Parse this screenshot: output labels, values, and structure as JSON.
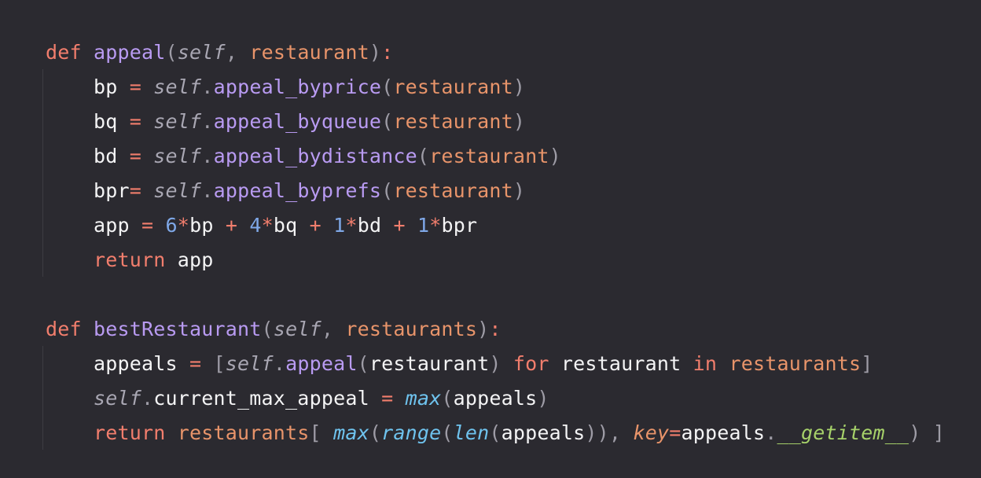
{
  "code": {
    "lines": [
      {
        "tokens": [
          {
            "t": "kw",
            "v": "def "
          },
          {
            "t": "fn",
            "v": "appeal"
          },
          {
            "t": "br",
            "v": "("
          },
          {
            "t": "slf",
            "v": "self"
          },
          {
            "t": "br",
            "v": ", "
          },
          {
            "t": "par",
            "v": "restaurant"
          },
          {
            "t": "br",
            "v": ")"
          },
          {
            "t": "op",
            "v": ":"
          }
        ]
      },
      {
        "tokens": [
          {
            "t": "tx",
            "v": "    bp "
          },
          {
            "t": "op",
            "v": "= "
          },
          {
            "t": "slf",
            "v": "self"
          },
          {
            "t": "br",
            "v": "."
          },
          {
            "t": "fn",
            "v": "appeal_byprice"
          },
          {
            "t": "br",
            "v": "("
          },
          {
            "t": "par",
            "v": "restaurant"
          },
          {
            "t": "br",
            "v": ")"
          }
        ]
      },
      {
        "tokens": [
          {
            "t": "tx",
            "v": "    bq "
          },
          {
            "t": "op",
            "v": "= "
          },
          {
            "t": "slf",
            "v": "self"
          },
          {
            "t": "br",
            "v": "."
          },
          {
            "t": "fn",
            "v": "appeal_byqueue"
          },
          {
            "t": "br",
            "v": "("
          },
          {
            "t": "par",
            "v": "restaurant"
          },
          {
            "t": "br",
            "v": ")"
          }
        ]
      },
      {
        "tokens": [
          {
            "t": "tx",
            "v": "    bd "
          },
          {
            "t": "op",
            "v": "= "
          },
          {
            "t": "slf",
            "v": "self"
          },
          {
            "t": "br",
            "v": "."
          },
          {
            "t": "fn",
            "v": "appeal_bydistance"
          },
          {
            "t": "br",
            "v": "("
          },
          {
            "t": "par",
            "v": "restaurant"
          },
          {
            "t": "br",
            "v": ")"
          }
        ]
      },
      {
        "tokens": [
          {
            "t": "tx",
            "v": "    bpr"
          },
          {
            "t": "op",
            "v": "= "
          },
          {
            "t": "slf",
            "v": "self"
          },
          {
            "t": "br",
            "v": "."
          },
          {
            "t": "fn",
            "v": "appeal_byprefs"
          },
          {
            "t": "br",
            "v": "("
          },
          {
            "t": "par",
            "v": "restaurant"
          },
          {
            "t": "br",
            "v": ")"
          }
        ]
      },
      {
        "tokens": [
          {
            "t": "tx",
            "v": "    app "
          },
          {
            "t": "op",
            "v": "= "
          },
          {
            "t": "num",
            "v": "6"
          },
          {
            "t": "op",
            "v": "*"
          },
          {
            "t": "tx",
            "v": "bp "
          },
          {
            "t": "op",
            "v": "+ "
          },
          {
            "t": "num",
            "v": "4"
          },
          {
            "t": "op",
            "v": "*"
          },
          {
            "t": "tx",
            "v": "bq "
          },
          {
            "t": "op",
            "v": "+ "
          },
          {
            "t": "num",
            "v": "1"
          },
          {
            "t": "op",
            "v": "*"
          },
          {
            "t": "tx",
            "v": "bd "
          },
          {
            "t": "op",
            "v": "+ "
          },
          {
            "t": "num",
            "v": "1"
          },
          {
            "t": "op",
            "v": "*"
          },
          {
            "t": "tx",
            "v": "bpr"
          }
        ]
      },
      {
        "tokens": [
          {
            "t": "tx",
            "v": "    "
          },
          {
            "t": "kw",
            "v": "return "
          },
          {
            "t": "tx",
            "v": "app"
          }
        ]
      },
      {
        "tokens": []
      },
      {
        "tokens": [
          {
            "t": "kw",
            "v": "def "
          },
          {
            "t": "fn",
            "v": "bestRestaurant"
          },
          {
            "t": "br",
            "v": "("
          },
          {
            "t": "slf",
            "v": "self"
          },
          {
            "t": "br",
            "v": ", "
          },
          {
            "t": "par",
            "v": "restaurants"
          },
          {
            "t": "br",
            "v": ")"
          },
          {
            "t": "op",
            "v": ":"
          }
        ]
      },
      {
        "tokens": [
          {
            "t": "tx",
            "v": "    appeals "
          },
          {
            "t": "op",
            "v": "= "
          },
          {
            "t": "br",
            "v": "["
          },
          {
            "t": "slf",
            "v": "self"
          },
          {
            "t": "br",
            "v": "."
          },
          {
            "t": "fn",
            "v": "appeal"
          },
          {
            "t": "br",
            "v": "("
          },
          {
            "t": "tx",
            "v": "restaurant"
          },
          {
            "t": "br",
            "v": ") "
          },
          {
            "t": "kw",
            "v": "for "
          },
          {
            "t": "tx",
            "v": "restaurant "
          },
          {
            "t": "kw",
            "v": "in "
          },
          {
            "t": "par",
            "v": "restaurants"
          },
          {
            "t": "br",
            "v": "]"
          }
        ]
      },
      {
        "tokens": [
          {
            "t": "tx",
            "v": "    "
          },
          {
            "t": "slf",
            "v": "self"
          },
          {
            "t": "br",
            "v": "."
          },
          {
            "t": "tx",
            "v": "current_max_appeal "
          },
          {
            "t": "op",
            "v": "= "
          },
          {
            "t": "bi",
            "v": "max"
          },
          {
            "t": "br",
            "v": "("
          },
          {
            "t": "tx",
            "v": "appeals"
          },
          {
            "t": "br",
            "v": ")"
          }
        ]
      },
      {
        "tokens": [
          {
            "t": "tx",
            "v": "    "
          },
          {
            "t": "kw",
            "v": "return "
          },
          {
            "t": "par",
            "v": "restaurants"
          },
          {
            "t": "br",
            "v": "[ "
          },
          {
            "t": "bi",
            "v": "max"
          },
          {
            "t": "br",
            "v": "("
          },
          {
            "t": "bi",
            "v": "range"
          },
          {
            "t": "br",
            "v": "("
          },
          {
            "t": "bi",
            "v": "len"
          },
          {
            "t": "br",
            "v": "("
          },
          {
            "t": "tx",
            "v": "appeals"
          },
          {
            "t": "br",
            "v": ")), "
          },
          {
            "t": "kwa",
            "v": "key"
          },
          {
            "t": "op",
            "v": "="
          },
          {
            "t": "tx",
            "v": "appeals"
          },
          {
            "t": "br",
            "v": "."
          },
          {
            "t": "dun",
            "v": "__getitem__"
          },
          {
            "t": "br",
            "v": ") ]"
          }
        ]
      }
    ]
  }
}
